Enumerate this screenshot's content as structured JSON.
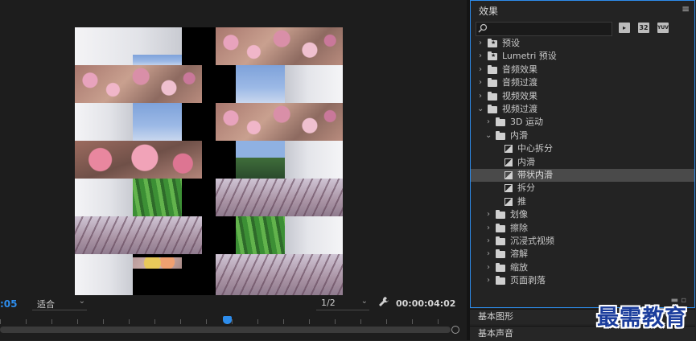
{
  "monitor": {
    "timecode_left": ":05",
    "fit_label": "适合",
    "resolution_label": "1/2",
    "timecode_right": "00:00:04:02"
  },
  "effects": {
    "title": "效果",
    "menu_icon": "≡",
    "search_placeholder": "",
    "toolbar": [
      {
        "icon": "accelerated-effects-icon",
        "label": ""
      },
      {
        "icon": "32-bit-icon",
        "label": "32"
      },
      {
        "icon": "yuv-icon",
        "label": "YUV"
      }
    ],
    "tree": [
      {
        "label": "预设",
        "type": "folder-star",
        "level": 0,
        "expanded": false
      },
      {
        "label": "Lumetri 预设",
        "type": "folder-star",
        "level": 0,
        "expanded": false
      },
      {
        "label": "音频效果",
        "type": "folder",
        "level": 0,
        "expanded": false
      },
      {
        "label": "音频过渡",
        "type": "folder",
        "level": 0,
        "expanded": false
      },
      {
        "label": "视频效果",
        "type": "folder",
        "level": 0,
        "expanded": false
      },
      {
        "label": "视频过渡",
        "type": "folder",
        "level": 0,
        "expanded": true
      },
      {
        "label": "3D 运动",
        "type": "folder",
        "level": 1,
        "expanded": false
      },
      {
        "label": "内滑",
        "type": "folder",
        "level": 1,
        "expanded": true
      },
      {
        "label": "中心拆分",
        "type": "effect",
        "level": 2
      },
      {
        "label": "内滑",
        "type": "effect",
        "level": 2
      },
      {
        "label": "带状内滑",
        "type": "effect",
        "level": 2,
        "selected": true
      },
      {
        "label": "拆分",
        "type": "effect",
        "level": 2
      },
      {
        "label": "推",
        "type": "effect",
        "level": 2
      },
      {
        "label": "划像",
        "type": "folder",
        "level": 1,
        "expanded": false
      },
      {
        "label": "擦除",
        "type": "folder",
        "level": 1,
        "expanded": false
      },
      {
        "label": "沉浸式视频",
        "type": "folder",
        "level": 1,
        "expanded": false
      },
      {
        "label": "溶解",
        "type": "folder",
        "level": 1,
        "expanded": false
      },
      {
        "label": "缩放",
        "type": "folder",
        "level": 1,
        "expanded": false
      },
      {
        "label": "页面剥落",
        "type": "folder",
        "level": 1,
        "expanded": false
      }
    ]
  },
  "bottom_panels": [
    "基本图形",
    "基本声音"
  ],
  "watermark": "最需教育",
  "colors": {
    "accent": "#2d8ceb",
    "selected_row": "#4a4a4a",
    "watermark": "#1b3d9c"
  }
}
